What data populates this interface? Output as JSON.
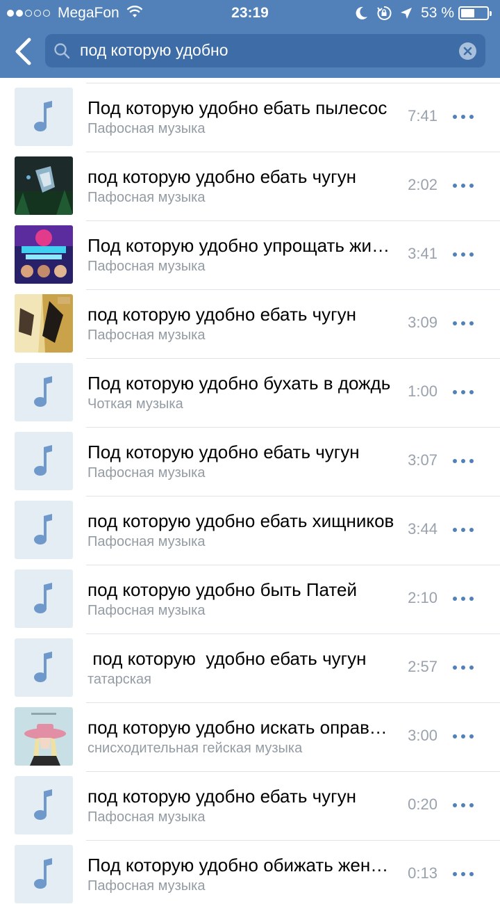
{
  "status_bar": {
    "carrier": "MegaFon",
    "signal_bars_filled": 2,
    "signal_bars_total": 5,
    "time": "23:19",
    "battery_percent": "53 %",
    "battery_level": 0.53
  },
  "search": {
    "query": "под которую удобно"
  },
  "tracks": [
    {
      "title": "Под которую удобно ебать пылесос",
      "artist": "Пафосная музыка",
      "duration": "7:41",
      "cover": "note-placeholder"
    },
    {
      "title": "под которую удобно ебать чугун",
      "artist": "Пафосная музыка",
      "duration": "2:02",
      "cover": "artwork-forest"
    },
    {
      "title": "Под которую удобно упрощать жизнь",
      "artist": "Пафосная музыка",
      "duration": "3:41",
      "cover": "artwork-compilation"
    },
    {
      "title": "под которую удобно ебать чугун",
      "artist": "Пафосная музыка",
      "duration": "3:09",
      "cover": "artwork-faces"
    },
    {
      "title": "Под которую удобно бухать в дождь",
      "artist": "Чоткая музыка",
      "duration": "1:00",
      "cover": "note-placeholder"
    },
    {
      "title": "Под которую удобно ебать чугун",
      "artist": "Пафосная музыка",
      "duration": "3:07",
      "cover": "note-placeholder"
    },
    {
      "title": "под которую удобно ебать хищников",
      "artist": "Пафосная музыка",
      "duration": "3:44",
      "cover": "note-placeholder"
    },
    {
      "title": "под которую удобно быть Патей",
      "artist": "Пафосная музыка",
      "duration": "2:10",
      "cover": "note-placeholder"
    },
    {
      "title": " под которую  удобно ебать чугун",
      "artist": "татарская",
      "duration": "2:57",
      "cover": "note-placeholder"
    },
    {
      "title": "под которую удобно искать оправдания",
      "artist": "снисходительная гейская музыка",
      "duration": "3:00",
      "cover": "artwork-pink-hat"
    },
    {
      "title": "под которую удобно ебать чугун",
      "artist": "Пафосная музыка",
      "duration": "0:20",
      "cover": "note-placeholder"
    },
    {
      "title": "Под которую удобно обижать женщин",
      "artist": "Пафосная музыка",
      "duration": "0:13",
      "cover": "note-placeholder"
    }
  ],
  "colors": {
    "header": "#5181b8",
    "search_field": "#3e6ca6",
    "accent": "#5181b8",
    "placeholder_bg": "#e4ecf4",
    "placeholder_note": "#6f98cb",
    "secondary_text": "#939ba3",
    "separator": "#dfe3e8"
  },
  "icons": {
    "back": "chevron-left-icon",
    "search": "search-icon",
    "clear": "clear-icon",
    "more": "more-horizontal-icon",
    "placeholder": "music-note-icon"
  }
}
